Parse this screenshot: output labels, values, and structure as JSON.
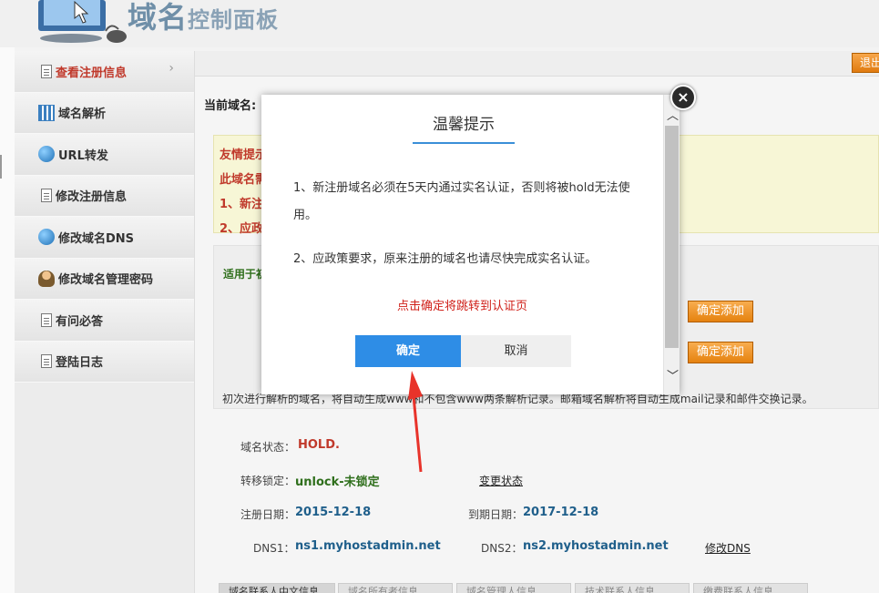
{
  "header": {
    "logo_main": "域名",
    "logo_sub": "控制面板"
  },
  "sidebar": {
    "items": [
      {
        "label": "查看注册信息",
        "icon": "document-icon",
        "active": true
      },
      {
        "label": "域名解析",
        "icon": "grid-icon",
        "active": false
      },
      {
        "label": "URL转发",
        "icon": "globe-icon",
        "active": false
      },
      {
        "label": "修改注册信息",
        "icon": "document-icon",
        "active": false
      },
      {
        "label": "修改域名DNS",
        "icon": "globe-icon",
        "active": false
      },
      {
        "label": "修改域名管理密码",
        "icon": "user-icon",
        "active": false
      },
      {
        "label": "有问必答",
        "icon": "document-icon",
        "active": false
      },
      {
        "label": "登陆日志",
        "icon": "document-icon",
        "active": false
      }
    ]
  },
  "topbar": {
    "logout": "退出"
  },
  "main": {
    "current_domain_label": "当前域名:",
    "notice": {
      "l1": "友情提示",
      "l2": "此域名需",
      "l3": "1、新注",
      "l4": "2、应政"
    },
    "apply_title": "适用于初",
    "add_button": "确定添加",
    "tip": "初次进行解析的域名，将自动生成www和不包含www两条解析记录。邮箱域名解析将自动生成mail记录和邮件交换记录。"
  },
  "status": {
    "domain_status_label": "域名状态：",
    "domain_status": "HOLD.",
    "transfer_lock_label": "转移锁定：",
    "transfer_lock": "unlock-未锁定",
    "change_status": "变更状态",
    "reg_date_label": "注册日期：",
    "reg_date": "2015-12-18",
    "expire_date_label": "到期日期：",
    "expire_date": "2017-12-18",
    "dns1_label": "DNS1：",
    "dns1": "ns1.myhostadmin.net",
    "dns2_label": "DNS2：",
    "dns2": "ns2.myhostadmin.net",
    "modify_dns": "修改DNS"
  },
  "bottom_tabs": [
    "域名联系人中文信息",
    "域名所有者信息",
    "域名管理人信息",
    "技术联系人信息",
    "缴费联系人信息"
  ],
  "modal": {
    "title": "温馨提示",
    "line1": "1、新注册域名必须在5天内通过实名认证，否则将被hold无法使用。",
    "line2": "2、应政策要求，原来注册的域名也请尽快完成实名认证。",
    "hint": "点击确定将跳转到认证页",
    "ok": "确定",
    "cancel": "取消",
    "close": "×"
  },
  "colors": {
    "accent": "#2e8de6",
    "warning_red": "#d0211a",
    "orange_button": "#e5820f"
  }
}
